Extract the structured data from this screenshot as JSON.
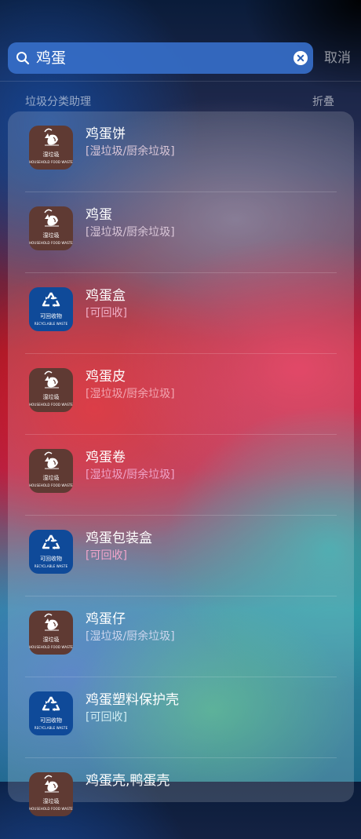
{
  "search": {
    "query": "鸡蛋",
    "cancel_label": "取消"
  },
  "section": {
    "title": "垃圾分类助理",
    "action_label": "折叠"
  },
  "icon_labels": {
    "food": {
      "cn": "湿垃圾",
      "en": "HOUSEHOLD FOOD WASTE"
    },
    "recycle": {
      "cn": "可回收物",
      "en": "RECYCLABLE WASTE"
    }
  },
  "results": [
    {
      "name": "鸡蛋饼",
      "category": "[湿垃圾/厨余垃圾]",
      "icon": "food-waste-icon"
    },
    {
      "name": "鸡蛋",
      "category": "[湿垃圾/厨余垃圾]",
      "icon": "food-waste-icon"
    },
    {
      "name": "鸡蛋盒",
      "category": "[可回收]",
      "icon": "recycle-icon"
    },
    {
      "name": "鸡蛋皮",
      "category": "[湿垃圾/厨余垃圾]",
      "icon": "food-waste-icon"
    },
    {
      "name": "鸡蛋卷",
      "category": "[湿垃圾/厨余垃圾]",
      "icon": "food-waste-icon"
    },
    {
      "name": "鸡蛋包装盒",
      "category": "[可回收]",
      "icon": "recycle-icon"
    },
    {
      "name": "鸡蛋仔",
      "category": "[湿垃圾/厨余垃圾]",
      "icon": "food-waste-icon"
    },
    {
      "name": "鸡蛋塑料保护壳",
      "category": "[可回收]",
      "icon": "recycle-icon"
    },
    {
      "name": "鸡蛋壳,鸭蛋壳",
      "category": "",
      "icon": "food-waste-icon"
    }
  ],
  "colors": {
    "food_icon_bg": "#5f3a33",
    "recycle_icon_bg": "#0f4a99",
    "search_bar": "#366ec8"
  }
}
